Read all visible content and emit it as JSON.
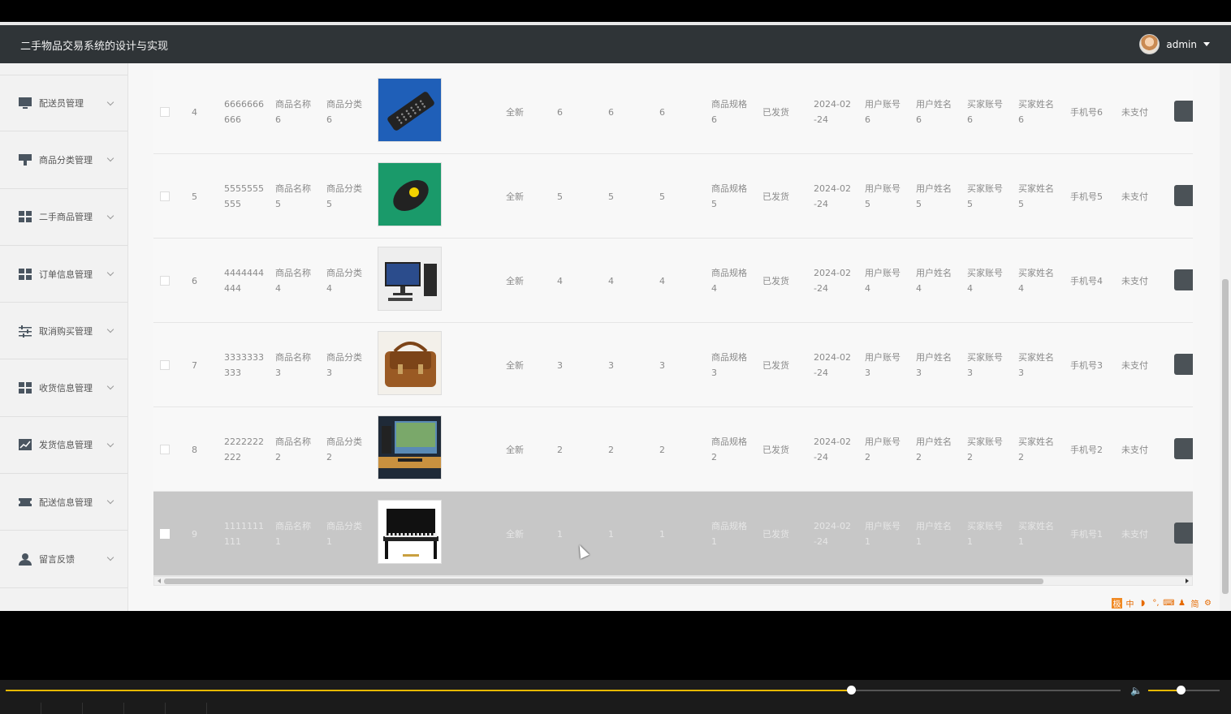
{
  "app": {
    "title": "二手物品交易系统的设计与实现",
    "user": "admin"
  },
  "sidebar": {
    "items": [
      {
        "label": "配送员管理",
        "icon": "monitor-icon"
      },
      {
        "label": "商品分类管理",
        "icon": "kiosk-icon"
      },
      {
        "label": "二手商品管理",
        "icon": "grid-icon"
      },
      {
        "label": "订单信息管理",
        "icon": "grid-icon"
      },
      {
        "label": "取消购买管理",
        "icon": "sliders-icon"
      },
      {
        "label": "收货信息管理",
        "icon": "grid-icon"
      },
      {
        "label": "发货信息管理",
        "icon": "chart-icon"
      },
      {
        "label": "配送信息管理",
        "icon": "ticket-icon"
      },
      {
        "label": "留言反馈",
        "icon": "user-icon"
      }
    ]
  },
  "table": {
    "rows": [
      {
        "idx": "4",
        "no_a": "6666666",
        "no_b": "666",
        "name_a": "商品名称",
        "name_b": "6",
        "cat_a": "商品分类",
        "cat_b": "6",
        "image": "remote-control",
        "cond": "全新",
        "c1": "6",
        "c2": "6",
        "c3": "6",
        "spec_a": "商品规格",
        "spec_b": "6",
        "ship": "已发货",
        "date_a": "2024-02",
        "date_b": "-24",
        "ua_a": "用户账号",
        "ua_b": "6",
        "un_a": "用户姓名",
        "un_b": "6",
        "ba_a": "买家账号",
        "ba_b": "6",
        "bn_a": "买家姓名",
        "bn_b": "6",
        "phone": "手机号6",
        "pay": "未支付",
        "selected": false
      },
      {
        "idx": "5",
        "no_a": "5555555",
        "no_b": "555",
        "name_a": "商品名称",
        "name_b": "5",
        "cat_a": "商品分类",
        "cat_b": "5",
        "image": "pager-device",
        "cond": "全新",
        "c1": "5",
        "c2": "5",
        "c3": "5",
        "spec_a": "商品规格",
        "spec_b": "5",
        "ship": "已发货",
        "date_a": "2024-02",
        "date_b": "-24",
        "ua_a": "用户账号",
        "ua_b": "5",
        "un_a": "用户姓名",
        "un_b": "5",
        "ba_a": "买家账号",
        "ba_b": "5",
        "bn_a": "买家姓名",
        "bn_b": "5",
        "phone": "手机号5",
        "pay": "未支付",
        "selected": false
      },
      {
        "idx": "6",
        "no_a": "4444444",
        "no_b": "444",
        "name_a": "商品名称",
        "name_b": "4",
        "cat_a": "商品分类",
        "cat_b": "4",
        "image": "desktop-computer",
        "cond": "全新",
        "c1": "4",
        "c2": "4",
        "c3": "4",
        "spec_a": "商品规格",
        "spec_b": "4",
        "ship": "已发货",
        "date_a": "2024-02",
        "date_b": "-24",
        "ua_a": "用户账号",
        "ua_b": "4",
        "un_a": "用户姓名",
        "un_b": "4",
        "ba_a": "买家账号",
        "ba_b": "4",
        "bn_a": "买家姓名",
        "bn_b": "4",
        "phone": "手机号4",
        "pay": "未支付",
        "selected": false
      },
      {
        "idx": "7",
        "no_a": "3333333",
        "no_b": "333",
        "name_a": "商品名称",
        "name_b": "3",
        "cat_a": "商品分类",
        "cat_b": "3",
        "image": "leather-bag",
        "cond": "全新",
        "c1": "3",
        "c2": "3",
        "c3": "3",
        "spec_a": "商品规格",
        "spec_b": "3",
        "ship": "已发货",
        "date_a": "2024-02",
        "date_b": "-24",
        "ua_a": "用户账号",
        "ua_b": "3",
        "un_a": "用户姓名",
        "un_b": "3",
        "ba_a": "买家账号",
        "ba_b": "3",
        "bn_a": "买家姓名",
        "bn_b": "3",
        "phone": "手机号3",
        "pay": "未支付",
        "selected": false
      },
      {
        "idx": "8",
        "no_a": "2222222",
        "no_b": "222",
        "name_a": "商品名称",
        "name_b": "2",
        "cat_a": "商品分类",
        "cat_b": "2",
        "image": "computer-desk",
        "cond": "全新",
        "c1": "2",
        "c2": "2",
        "c3": "2",
        "spec_a": "商品规格",
        "spec_b": "2",
        "ship": "已发货",
        "date_a": "2024-02",
        "date_b": "-24",
        "ua_a": "用户账号",
        "ua_b": "2",
        "un_a": "用户姓名",
        "un_b": "2",
        "ba_a": "买家账号",
        "ba_b": "2",
        "bn_a": "买家姓名",
        "bn_b": "2",
        "phone": "手机号2",
        "pay": "未支付",
        "selected": false
      },
      {
        "idx": "9",
        "no_a": "1111111",
        "no_b": "111",
        "name_a": "商品名称",
        "name_b": "1",
        "cat_a": "商品分类",
        "cat_b": "1",
        "image": "piano",
        "cond": "全新",
        "c1": "1",
        "c2": "1",
        "c3": "1",
        "spec_a": "商品规格",
        "spec_b": "1",
        "ship": "已发货",
        "date_a": "2024-02",
        "date_b": "-24",
        "ua_a": "用户账号",
        "ua_b": "1",
        "un_a": "用户姓名",
        "un_b": "1",
        "ba_a": "买家账号",
        "ba_b": "1",
        "bn_a": "买家姓名",
        "bn_b": "1",
        "phone": "手机号1",
        "pay": "未支付",
        "selected": true
      }
    ]
  },
  "ime": [
    "极",
    "中",
    "◗",
    "°,",
    "⌨",
    "♟",
    "简",
    "⚙"
  ],
  "player": {
    "progress": 0.758,
    "volume": 0.45
  },
  "colors": {
    "topbar": "#2f3437",
    "accent": "#e6b800",
    "selected_row": "#c7c7c7"
  }
}
